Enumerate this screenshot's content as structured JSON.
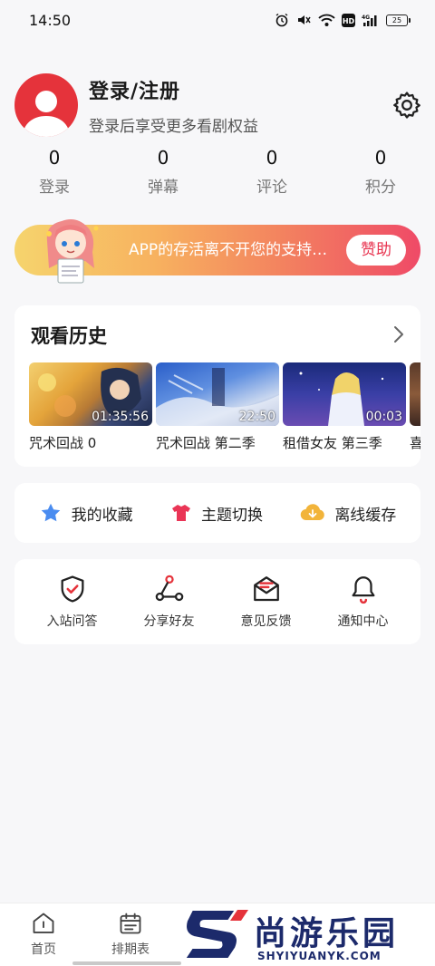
{
  "status_bar": {
    "time": "14:50",
    "battery": "25"
  },
  "profile": {
    "title": "登录/注册",
    "subtitle": "登录后享受更多看剧权益"
  },
  "stats": [
    {
      "value": "0",
      "label": "登录"
    },
    {
      "value": "0",
      "label": "弹幕"
    },
    {
      "value": "0",
      "label": "评论"
    },
    {
      "value": "0",
      "label": "积分"
    }
  ],
  "banner": {
    "text": "APP的存活离不开您的支持…",
    "button": "赞助"
  },
  "history": {
    "title": "观看历史",
    "items": [
      {
        "name": "咒术回战 0",
        "time": "01:35:56"
      },
      {
        "name": "咒术回战 第二季",
        "time": "22:50"
      },
      {
        "name": "租借女友 第三季",
        "time": "00:03"
      },
      {
        "name": "喜",
        "time": ""
      }
    ]
  },
  "quick": [
    {
      "label": "我的收藏",
      "icon": "star-icon",
      "color": "#4a8cf0"
    },
    {
      "label": "主题切换",
      "icon": "shirt-icon",
      "color": "#ea3556"
    },
    {
      "label": "离线缓存",
      "icon": "cloud-download-icon",
      "color": "#f2b43a"
    }
  ],
  "tools": [
    {
      "label": "入站问答",
      "icon": "shield-check-icon"
    },
    {
      "label": "分享好友",
      "icon": "share-icon"
    },
    {
      "label": "意见反馈",
      "icon": "feedback-mail-icon"
    },
    {
      "label": "通知中心",
      "icon": "bell-icon"
    }
  ],
  "tabbar": {
    "home": "首页",
    "schedule": "排期表"
  },
  "watermark": {
    "text": "尚游乐园",
    "url": "SHYIYUANYK.COM"
  },
  "colors": {
    "accent": "#e5333b",
    "banner_end": "#ef4a67",
    "donate_text": "#e8334f"
  }
}
